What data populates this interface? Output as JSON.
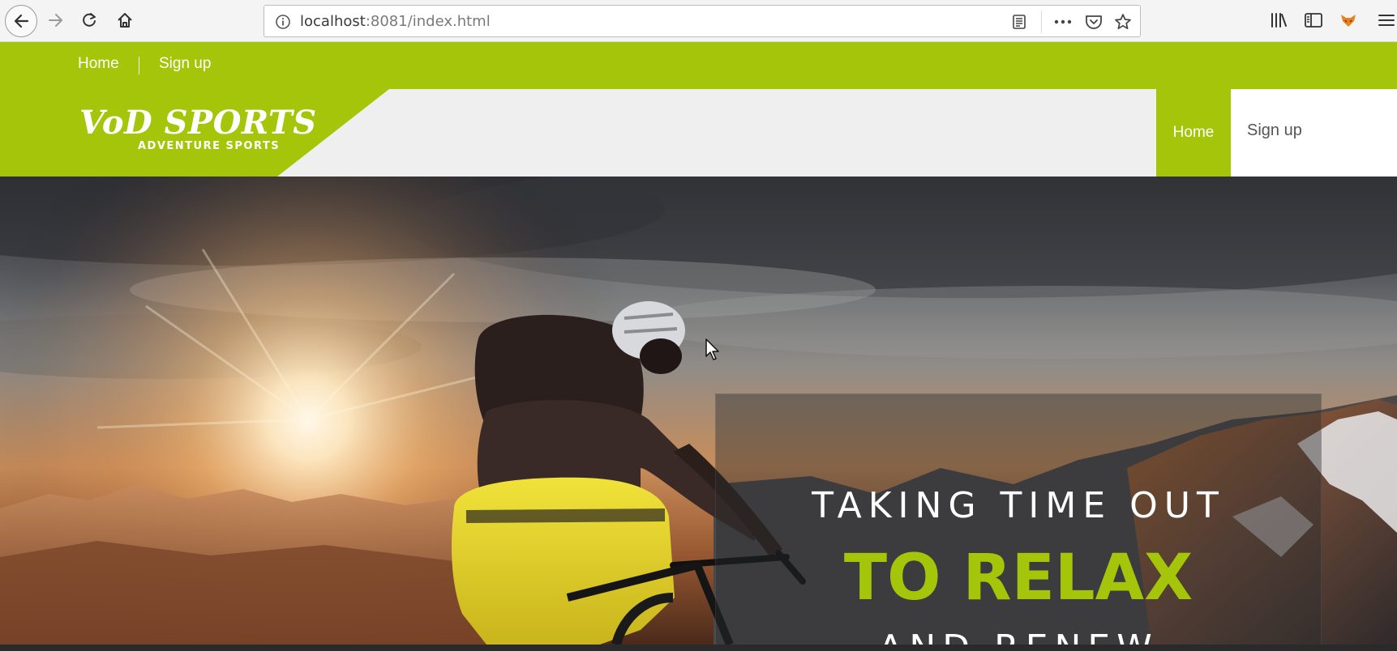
{
  "browser": {
    "url_host": "localhost",
    "url_rest": ":8081/index.html",
    "icons": [
      "back-arrow-icon",
      "forward-arrow-icon",
      "reload-icon",
      "home-icon",
      "info-icon",
      "reader-view-icon",
      "more-icon",
      "pocket-icon",
      "bookmark-star-icon",
      "library-icon",
      "sidebar-icon",
      "extension-fox-icon",
      "menu-icon"
    ]
  },
  "top_strip": {
    "links": [
      "Home",
      "Sign up"
    ]
  },
  "header": {
    "logo_title": "VoD SPORTS",
    "logo_subtitle": "ADVENTURE SPORTS",
    "nav": {
      "home": "Home",
      "signup": "Sign up"
    }
  },
  "hero": {
    "line1": "TAKING TIME OUT",
    "line2": "TO RELAX",
    "line3": "AND RENEW"
  },
  "colors": {
    "brand_green": "#a4c50a",
    "header_bg": "#efefef"
  }
}
